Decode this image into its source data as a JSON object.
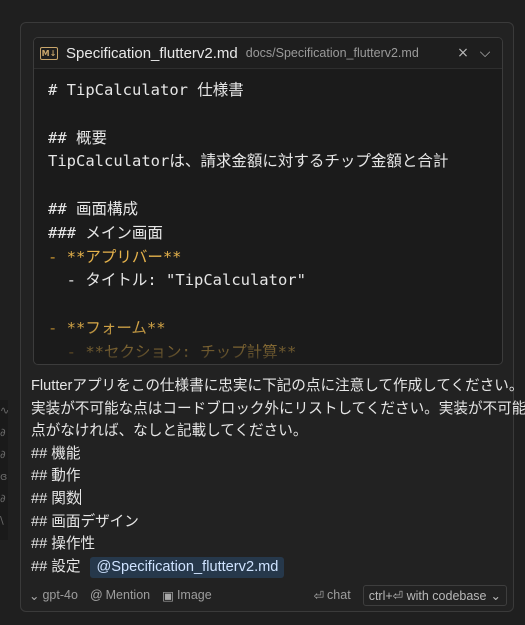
{
  "file_card": {
    "icon_text": "M↓",
    "file_name": "Specification_flutterv2.md",
    "file_path": "docs/Specification_flutterv2.md",
    "close_icon": "×",
    "chevron_icon": "⌵",
    "lines": [
      {
        "prefix": "",
        "bold": "",
        "text": "# TipCalculator 仕様書"
      },
      {
        "prefix": "",
        "bold": "",
        "text": ""
      },
      {
        "prefix": "",
        "bold": "",
        "text": "## 概要"
      },
      {
        "prefix": "",
        "bold": "",
        "text": "TipCalculatorは、請求金額に対するチップ金額と合計"
      },
      {
        "prefix": "",
        "bold": "",
        "text": ""
      },
      {
        "prefix": "",
        "bold": "",
        "text": "## 画面構成"
      },
      {
        "prefix": "",
        "bold": "",
        "text": "### メイン画面"
      },
      {
        "prefix": "- ",
        "bold": "**アプリバー**",
        "text": ""
      },
      {
        "prefix": "",
        "bold": "",
        "text": "  - タイトル: \"TipCalculator\""
      },
      {
        "prefix": "",
        "bold": "",
        "text": ""
      },
      {
        "prefix": "- ",
        "bold": "**フォーム**",
        "text": ""
      },
      {
        "prefix": "  - ",
        "bold": "**セクション: チップ計算**",
        "text": ""
      }
    ]
  },
  "prompt": {
    "lines": [
      "Flutterアプリをこの仕様書に忠実に下記の点に注意して作成してください。",
      "実装が不可能な点はコードブロック外にリストしてください。実装が不可能な",
      "点がなければ、なしと記載してください。",
      "## 機能",
      "## 動作",
      "## 関数",
      "## 画面デザイン",
      "## 操作性",
      "## 設定"
    ],
    "mention_chip": "@Specification_flutterv2.md"
  },
  "toolbar": {
    "model": "gpt-4o",
    "mention": "Mention",
    "image": "Image",
    "chat": "chat",
    "codebase": "ctrl+⏎ with codebase"
  },
  "colors": {
    "accent_chip": "#26384b",
    "markdown_bold": "#e5b24b",
    "markdown_bullet": "#cd9731"
  }
}
